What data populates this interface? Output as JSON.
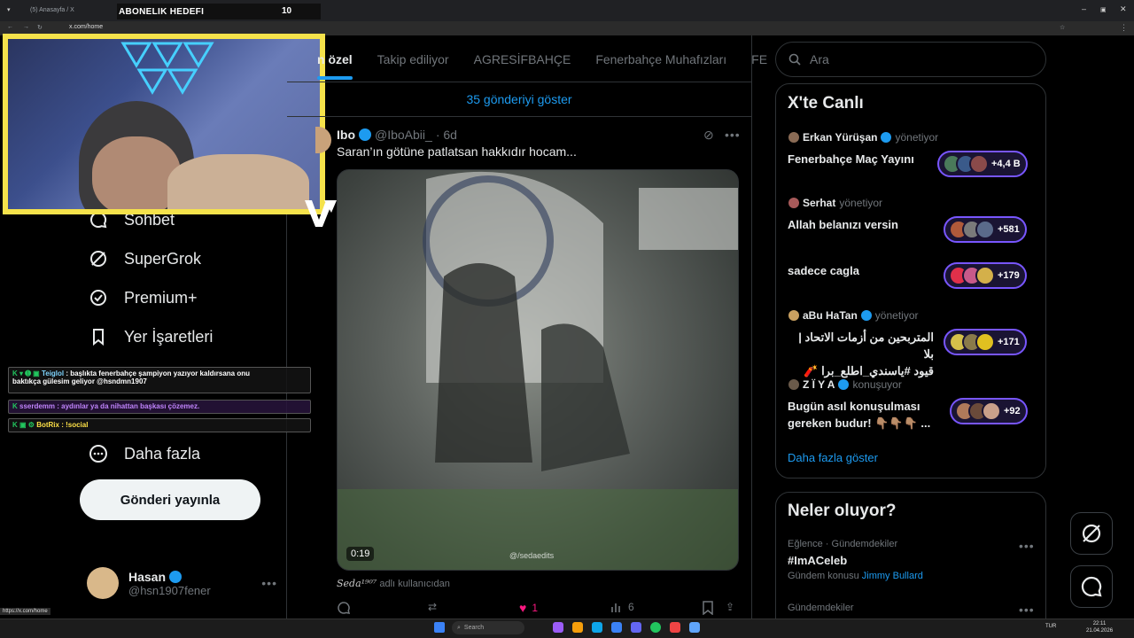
{
  "browser": {
    "tab_title": "(5) Anasayfa / X",
    "address": "x.com/home",
    "status_url": "https://x.com/home"
  },
  "overlay": {
    "sub_goal_label": "ABONELIK HEDEFI",
    "sub_goal_count": "10"
  },
  "nav": {
    "items": [
      {
        "label": "Sohbet",
        "icon": "chat-bubble-icon"
      },
      {
        "label": "SuperGrok",
        "icon": "grok-icon"
      },
      {
        "label": "Premium+",
        "icon": "verified-badge-icon"
      },
      {
        "label": "Yer İşaretleri",
        "icon": "bookmark-icon"
      },
      {
        "label": "Daha fazla",
        "icon": "more-circle-icon"
      }
    ],
    "post_button": "Gönderi yayınla",
    "user": {
      "name": "Hasan",
      "handle": "@hsn1907fener"
    }
  },
  "chat": [
    {
      "user": "Teiglol",
      "text": ": başlıkta fenerbahçe şampiyon yazıyor kaldırsana onu",
      "text2": "baktıkça gülesim geliyor @hsndmn1907"
    },
    {
      "user": "sserdemm",
      "text": ": aydınlar ya da nihattan başkası çözemez."
    },
    {
      "user": "BotRix",
      "text": ": !social"
    }
  ],
  "main": {
    "tabs": [
      "n özel",
      "Takip ediliyor",
      "AGRESİFBAHÇE",
      "Fenerbahçe Muhafızları",
      "FE"
    ],
    "show_posts": "35 gönderiyi göster",
    "tweet": {
      "name": "Ibo",
      "handle": "@IboAbii_",
      "time": "· 6d",
      "text": "Saran’ın götüne patlatsan hakkıdır hocam...",
      "video_time": "0:19",
      "watermark": "@/sedaedits",
      "credit_name": "Seda¹⁹⁰⁷",
      "credit_suffix": "adlı kullanıcıdan",
      "likes": "1",
      "views": "6"
    }
  },
  "right": {
    "search_placeholder": "Ara",
    "live_title": "X'te Canlı",
    "spaces": [
      {
        "host": "Erkan Yürüşan",
        "role": "yönetiyor",
        "title": "Fenerbahçe Maç Yayını",
        "count": "+4,4 B"
      },
      {
        "host": "Serhat",
        "role": "yönetiyor",
        "title": "Allah belanızı versin",
        "count": "+581"
      },
      {
        "host": "",
        "role": "",
        "title": "sadece cagla",
        "count": "+179"
      },
      {
        "host": "aBu HaTan",
        "role": "yönetiyor",
        "title": "المتربحين من أزمات الاتحاد | بلا",
        "title2": "قيود #ياسندي_اطلع_برا 🧨",
        "count": "+171"
      },
      {
        "host": "Z Ï Y A",
        "role": "konuşuyor",
        "title": "Bugün asıl konuşulması",
        "title2": "gereken budur! 👇🏽👇🏽👇🏽 ...",
        "count": "+92"
      }
    ],
    "more_link": "Daha fazla göster",
    "trends_title": "Neler oluyor?",
    "trends": [
      {
        "meta": "Eğlence · Gündemdekiler",
        "name": "#ImACeleb",
        "sub": "Gündem konusu",
        "sub_link": "Jimmy Bullard"
      },
      {
        "meta": "Gündemdekiler"
      }
    ]
  },
  "taskbar": {
    "search": "Search",
    "lang": "TUR",
    "time": "22:11",
    "date": "21.04.2026"
  }
}
